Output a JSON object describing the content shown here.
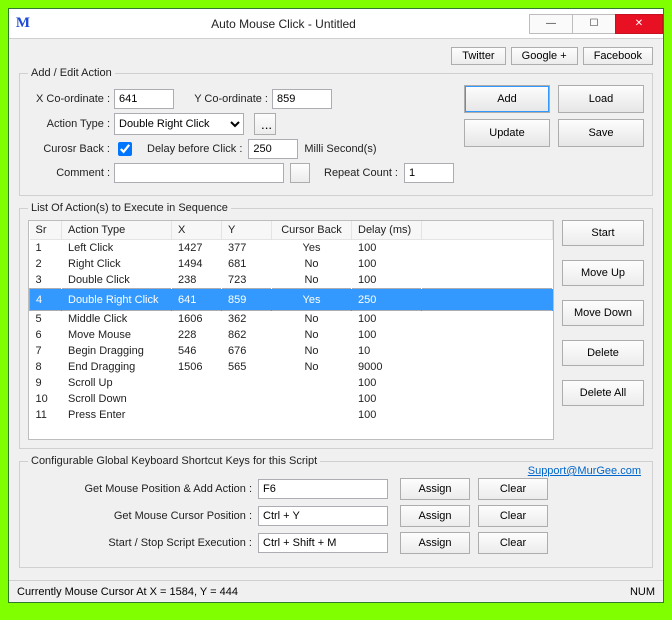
{
  "titlebar": {
    "app_icon": "M",
    "title": "Auto Mouse Click - Untitled"
  },
  "social": {
    "twitter": "Twitter",
    "google": "Google +",
    "facebook": "Facebook"
  },
  "addedit": {
    "legend": "Add / Edit Action",
    "x_label": "X Co-ordinate :",
    "x_value": "641",
    "y_label": "Y Co-ordinate :",
    "y_value": "859",
    "action_type_label": "Action Type :",
    "action_type_value": "Double Right Click",
    "browse": "...",
    "cursor_back_label": "Curosr Back :",
    "cursor_back_checked": true,
    "delay_label": "Delay before Click :",
    "delay_value": "250",
    "delay_unit": "Milli Second(s)",
    "comment_label": "Comment :",
    "comment_value": "",
    "repeat_label": "Repeat Count :",
    "repeat_value": "1",
    "add": "Add",
    "load": "Load",
    "update": "Update",
    "save": "Save"
  },
  "list": {
    "legend": "List Of Action(s) to Execute in Sequence",
    "headers": {
      "sr": "Sr",
      "type": "Action Type",
      "x": "X",
      "y": "Y",
      "cb": "Cursor Back",
      "delay": "Delay (ms)"
    },
    "rows": [
      {
        "sr": "1",
        "type": "Left Click",
        "x": "1427",
        "y": "377",
        "cb": "Yes",
        "delay": "100",
        "sel": false
      },
      {
        "sr": "2",
        "type": "Right Click",
        "x": "1494",
        "y": "681",
        "cb": "No",
        "delay": "100",
        "sel": false
      },
      {
        "sr": "3",
        "type": "Double Click",
        "x": "238",
        "y": "723",
        "cb": "No",
        "delay": "100",
        "sel": false
      },
      {
        "sr": "4",
        "type": "Double Right Click",
        "x": "641",
        "y": "859",
        "cb": "Yes",
        "delay": "250",
        "sel": true
      },
      {
        "sr": "5",
        "type": "Middle Click",
        "x": "1606",
        "y": "362",
        "cb": "No",
        "delay": "100",
        "sel": false
      },
      {
        "sr": "6",
        "type": "Move Mouse",
        "x": "228",
        "y": "862",
        "cb": "No",
        "delay": "100",
        "sel": false
      },
      {
        "sr": "7",
        "type": "Begin Dragging",
        "x": "546",
        "y": "676",
        "cb": "No",
        "delay": "10",
        "sel": false
      },
      {
        "sr": "8",
        "type": "End Dragging",
        "x": "1506",
        "y": "565",
        "cb": "No",
        "delay": "9000",
        "sel": false
      },
      {
        "sr": "9",
        "type": "Scroll Up",
        "x": "",
        "y": "",
        "cb": "",
        "delay": "100",
        "sel": false
      },
      {
        "sr": "10",
        "type": "Scroll Down",
        "x": "",
        "y": "",
        "cb": "",
        "delay": "100",
        "sel": false
      },
      {
        "sr": "11",
        "type": "Press Enter",
        "x": "",
        "y": "",
        "cb": "",
        "delay": "100",
        "sel": false
      }
    ],
    "side": {
      "start": "Start",
      "moveup": "Move Up",
      "movedown": "Move Down",
      "delete": "Delete",
      "deleteall": "Delete All"
    }
  },
  "shortcuts": {
    "legend": "Configurable Global Keyboard Shortcut Keys for this Script",
    "support": "Support@MurGee.com",
    "rows": [
      {
        "label": "Get Mouse Position & Add Action :",
        "value": "F6"
      },
      {
        "label": "Get Mouse Cursor Position :",
        "value": "Ctrl + Y"
      },
      {
        "label": "Start / Stop Script Execution :",
        "value": "Ctrl + Shift + M"
      }
    ],
    "assign": "Assign",
    "clear": "Clear"
  },
  "status": {
    "text": "Currently Mouse Cursor At X = 1584, Y = 444",
    "num": "NUM"
  }
}
